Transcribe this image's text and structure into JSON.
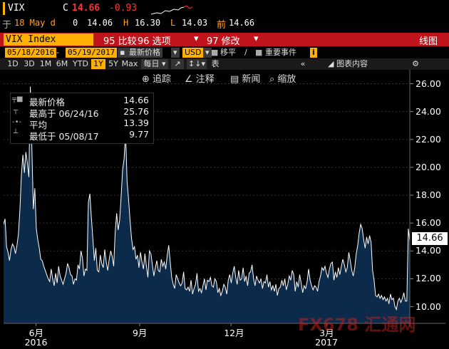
{
  "quote": {
    "ticker": "VIX",
    "c_label": "C",
    "last": "14.66",
    "change": "-0.93",
    "row2_prefix": "于",
    "date": "18 May d",
    "open_val": "0",
    "open2": "14.06",
    "h_label": "H",
    "high": "16.30",
    "l_label": "L",
    "low": "14.03",
    "prev_label": "前",
    "prev": "14.66"
  },
  "menubar": {
    "ticker_field": "VIX Index",
    "compare": "95 比较",
    "options": "96 选项",
    "modify": "97 修改",
    "view": "线图"
  },
  "daterow": {
    "start": "05/18/2016",
    "end": "05/19/2017",
    "price_type": "最新价格",
    "currency": "USD",
    "move": "移平",
    "events": "重要事件"
  },
  "periods": [
    "1D",
    "3D",
    "1M",
    "6M",
    "YTD",
    "1Y",
    "5Y",
    "Max"
  ],
  "period_active": "1Y",
  "period_extra": {
    "freq": "每日",
    "table": "表",
    "chart_content": "图表内容"
  },
  "toolbar": {
    "track": "追踪",
    "annotate": "注释",
    "news": "新闻",
    "zoom": "缩放"
  },
  "legend": {
    "items": [
      {
        "label": "最新价格",
        "value": "14.66"
      },
      {
        "label": "最高于 06/24/16",
        "value": "25.76"
      },
      {
        "label": "平均",
        "value": "13.39"
      },
      {
        "label": "最低于 05/08/17",
        "value": "9.77"
      }
    ]
  },
  "last_price_box": "14.66",
  "watermark": "FX678 汇通网",
  "chart_data": {
    "type": "area",
    "series": [
      {
        "values": [
          15.9,
          16.3,
          14.3,
          13.9,
          13.3,
          14.1,
          14.5,
          14.3,
          13.8,
          14.4,
          15.2,
          17.0,
          19.5,
          20.9,
          19.6,
          21.1,
          20.3,
          19.3,
          25.8,
          21.5,
          17.0,
          18.5,
          15.6,
          14.8,
          14.2,
          13.4,
          13.3,
          12.9,
          12.6,
          12.3,
          12.0,
          11.8,
          12.7,
          12.0,
          11.5,
          12.4,
          11.7,
          12.9,
          12.2,
          11.9,
          11.6,
          12.0,
          12.4,
          13.1,
          12.8,
          12.3,
          12.2,
          11.6,
          12.0,
          11.9,
          13.0,
          12.7,
          14.0,
          13.5,
          12.2,
          12.7,
          12.6,
          17.5,
          18.1,
          16.4,
          14.9,
          13.3,
          14.2,
          12.6,
          12.5,
          13.7,
          13.1,
          12.8,
          14.1,
          13.2,
          12.6,
          13.4,
          14.0,
          13.6,
          12.9,
          15.3,
          16.7,
          15.5,
          16.2,
          17.9,
          19.8,
          20.6,
          22.5,
          19.0,
          17.7,
          16.2,
          14.9,
          14.1,
          14.3,
          13.4,
          13.7,
          12.8,
          13.9,
          13.2,
          12.7,
          13.8,
          12.9,
          12.1,
          14.0,
          13.8,
          13.0,
          12.2,
          12.8,
          13.3,
          12.6,
          12.5,
          13.4,
          12.9,
          13.2,
          12.7,
          13.7,
          14.4,
          13.2,
          12.1,
          11.6,
          11.3,
          12.3,
          12.0,
          11.7,
          11.5,
          11.7,
          12.5,
          11.3,
          11.2,
          11.4,
          11.1,
          11.9,
          10.9,
          11.3,
          11.6,
          12.4,
          11.1,
          11.3,
          11.0,
          11.5,
          12.0,
          11.2,
          11.9,
          11.8,
          12.1,
          11.5,
          11.4,
          12.0,
          11.8,
          11.0,
          11.3,
          10.8,
          11.1,
          11.6,
          11.4,
          10.9,
          11.9,
          12.3,
          11.7,
          12.4,
          12.9,
          12.1,
          11.6,
          12.6,
          11.9,
          12.0,
          12.8,
          11.8,
          12.2,
          11.5,
          12.4,
          12.5,
          13.0,
          12.0,
          11.5,
          12.2,
          11.9,
          11.7,
          12.0,
          11.3,
          11.8,
          11.7,
          12.3,
          11.4,
          11.8,
          11.2,
          11.5,
          11.1,
          11.6,
          10.8,
          11.3,
          11.4,
          11.9,
          11.5,
          12.0,
          11.2,
          11.6,
          12.2,
          11.9,
          12.6,
          12.3,
          11.1,
          11.8,
          11.4,
          12.3,
          11.7,
          11.0,
          11.5,
          11.3,
          11.8,
          12.7,
          11.9,
          11.5,
          11.2,
          11.5,
          11.4,
          11.1,
          11.8,
          12.2,
          12.8,
          12.6,
          12.9,
          12.4,
          12.1,
          12.7,
          13.1,
          13.2,
          11.9,
          12.5,
          12.1,
          12.8,
          12.3,
          12.9,
          13.4,
          13.0,
          12.5,
          12.8,
          13.9,
          13.3,
          12.6,
          12.2,
          12.8,
          13.8,
          14.4,
          15.3,
          15.9,
          15.6,
          14.8,
          14.2,
          15.0,
          14.5,
          15.1,
          14.6,
          12.6,
          11.9,
          10.8,
          10.7,
          10.9,
          10.6,
          10.8,
          10.5,
          10.7,
          10.4,
          10.6,
          10.2,
          10.9,
          10.5,
          10.6,
          10.0,
          9.8,
          10.4,
          10.6,
          10.3,
          10.6,
          11.0,
          10.4,
          10.4,
          15.6,
          14.7
        ],
        "color": "#ffffff"
      }
    ],
    "ylim": [
      8.8,
      27.0
    ],
    "yticks": [
      "26.00",
      "24.00",
      "22.00",
      "20.00",
      "18.00",
      "16.00",
      "14.00",
      "12.00",
      "10.00"
    ],
    "xticks": [
      {
        "label": "6月",
        "year": "2016"
      },
      {
        "label": "9月",
        "year": ""
      },
      {
        "label": "12月",
        "year": ""
      },
      {
        "label": "3月",
        "year": "2017"
      }
    ],
    "grid": true,
    "fill_color": "#0c2a4a"
  }
}
